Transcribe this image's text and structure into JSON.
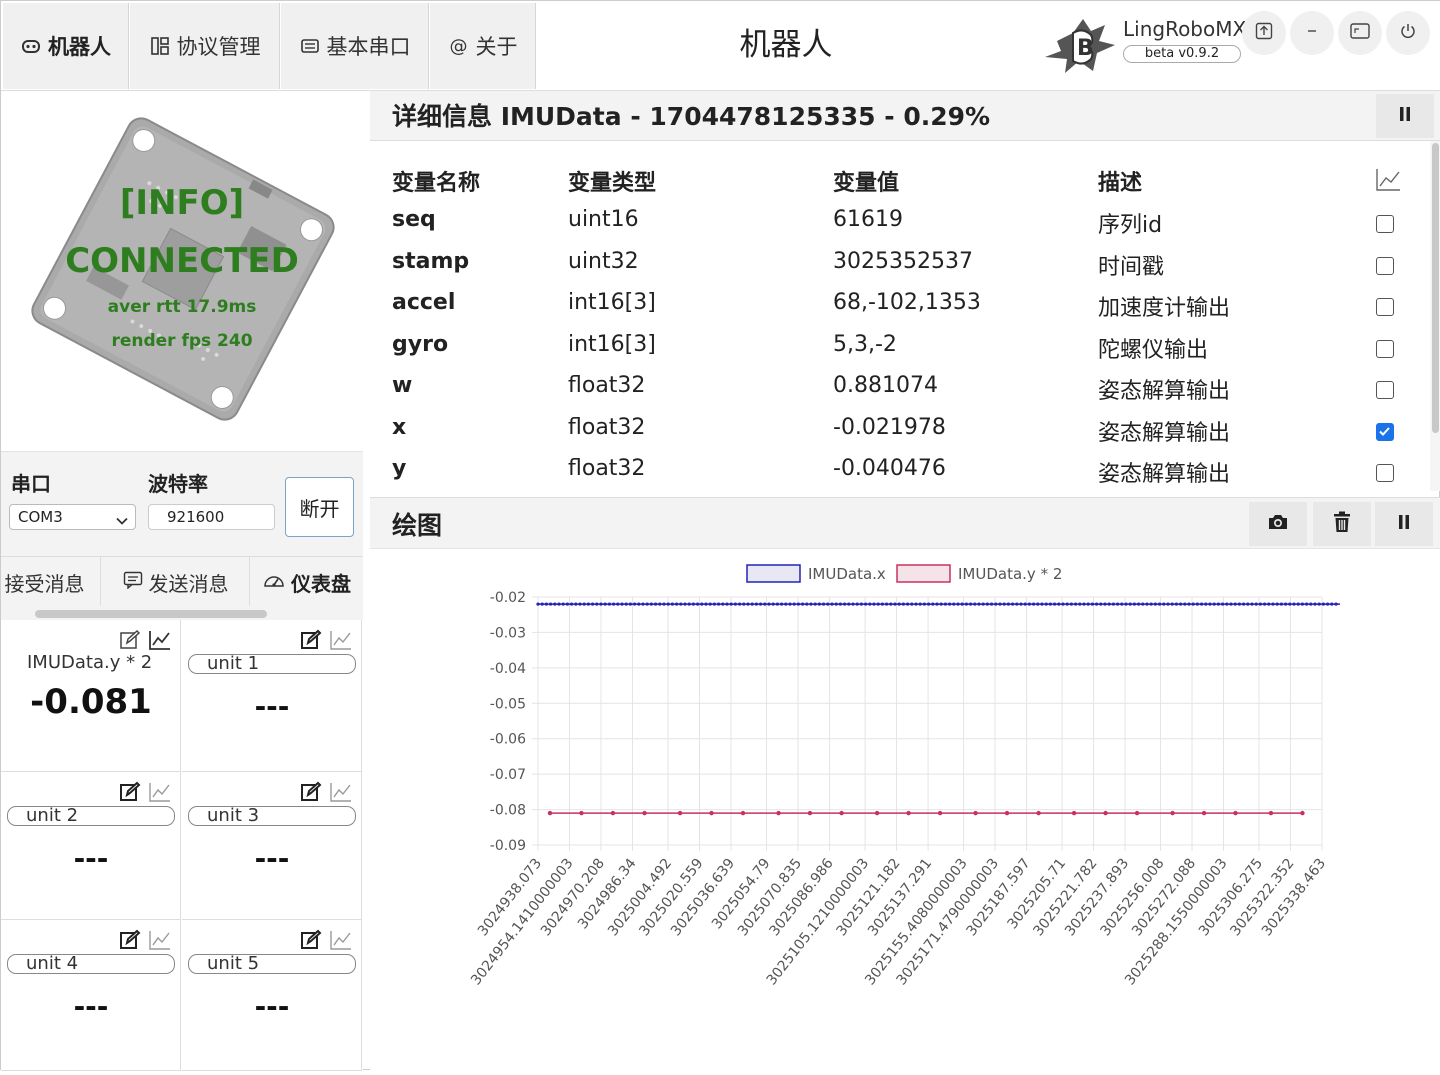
{
  "nav": {
    "tabs": [
      {
        "label": "机器人",
        "icon": "robot-icon"
      },
      {
        "label": "协议管理",
        "icon": "grid-icon"
      },
      {
        "label": "基本串口",
        "icon": "serial-icon"
      },
      {
        "label": "关于",
        "icon": "at-icon"
      }
    ],
    "active_index": 0
  },
  "window": {
    "title": "机器人",
    "brand_name": "LingRoboMX",
    "version": "beta v0.9.2"
  },
  "preview": {
    "info": "[INFO]",
    "status": "CONNECTED",
    "rtt": "aver rtt 17.9ms",
    "fps": "render fps 240"
  },
  "serial": {
    "port_label": "串口",
    "baud_label": "波特率",
    "port_value": "COM3",
    "baud_value": "921600",
    "disconnect_label": "断开"
  },
  "subtabs": [
    {
      "label": "接受消息",
      "icon": ""
    },
    {
      "label": "发送消息",
      "icon": "message-icon"
    },
    {
      "label": "仪表盘",
      "icon": "gauge-icon"
    }
  ],
  "gauges": [
    {
      "name": "IMUData.y * 2",
      "value": "-0.081"
    },
    {
      "name": "unit 1",
      "value": "---"
    },
    {
      "name": "unit 2",
      "value": "---"
    },
    {
      "name": "unit 3",
      "value": "---"
    },
    {
      "name": "unit 4",
      "value": "---"
    },
    {
      "name": "unit 5",
      "value": "---"
    }
  ],
  "detail": {
    "title": "详细信息 IMUData - 1704478125335 - 0.29%",
    "columns": [
      "变量名称",
      "变量类型",
      "变量值",
      "描述"
    ],
    "rows": [
      {
        "name": "seq",
        "type": "uint16",
        "value": "61619",
        "desc": "序列id",
        "plotted": false
      },
      {
        "name": "stamp",
        "type": "uint32",
        "value": "3025352537",
        "desc": "时间戳",
        "plotted": false
      },
      {
        "name": "accel",
        "type": "int16[3]",
        "value": "68,-102,1353",
        "desc": "加速度计输出",
        "plotted": false
      },
      {
        "name": "gyro",
        "type": "int16[3]",
        "value": "5,3,-2",
        "desc": "陀螺仪输出",
        "plotted": false
      },
      {
        "name": "w",
        "type": "float32",
        "value": "0.881074",
        "desc": "姿态解算输出",
        "plotted": false
      },
      {
        "name": "x",
        "type": "float32",
        "value": "-0.021978",
        "desc": "姿态解算输出",
        "plotted": true
      },
      {
        "name": "y",
        "type": "float32",
        "value": "-0.040476",
        "desc": "姿态解算输出",
        "plotted": false
      }
    ]
  },
  "plot": {
    "title": "绘图"
  },
  "chart_data": {
    "type": "line",
    "title": "",
    "xlabel": "",
    "ylabel": "",
    "ylim": [
      -0.09,
      -0.02
    ],
    "yticks": [
      -0.02,
      -0.03,
      -0.04,
      -0.05,
      -0.06,
      -0.07,
      -0.08,
      -0.09
    ],
    "x_tick_labels": [
      "3024938.073",
      "3024954.1410000003",
      "3024970.208",
      "3024986.34",
      "3025004.492",
      "3025020.559",
      "3025036.639",
      "3025054.79",
      "3025070.835",
      "3025086.986",
      "3025105.1210000003",
      "3025121.182",
      "3025137.291",
      "3025155.4080000003",
      "3025171.4790000003",
      "3025187.597",
      "3025205.71",
      "3025221.782",
      "3025237.893",
      "3025256.008",
      "3025272.088",
      "3025288.1550000003",
      "3025306.275",
      "3025322.352",
      "3025338.463"
    ],
    "xlim": [
      3024938.073,
      3025338.463
    ],
    "legend_position": "top",
    "series": [
      {
        "name": "IMUData.x",
        "color": "#2323b4",
        "x_start": 3024938.073,
        "x_end": 3025338.463,
        "y_constant": -0.022
      },
      {
        "name": "IMUData.y * 2",
        "color": "#c8325f",
        "x": [
          3024938.073,
          3024954.141,
          3024970.208,
          3024986.34,
          3025004.492,
          3025020.559,
          3025036.639,
          3025054.79,
          3025070.835,
          3025086.986,
          3025105.121,
          3025121.182,
          3025137.291,
          3025155.408,
          3025171.479,
          3025187.597,
          3025205.71,
          3025221.782,
          3025237.893,
          3025256.008,
          3025272.088,
          3025288.155,
          3025306.275,
          3025322.352
        ],
        "y_constant": -0.081
      }
    ]
  }
}
